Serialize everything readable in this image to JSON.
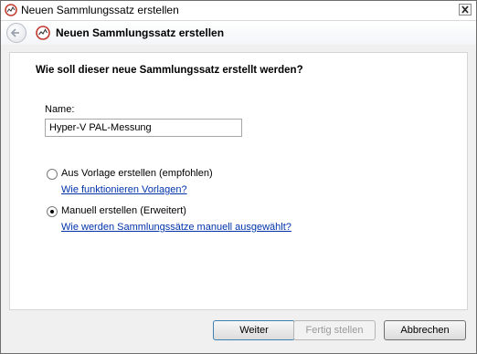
{
  "window": {
    "title": "Neuen Sammlungssatz erstellen"
  },
  "nav": {
    "title": "Neuen Sammlungssatz erstellen"
  },
  "page": {
    "question": "Wie soll dieser neue Sammlungssatz erstellt werden?",
    "name_label": "Name:",
    "name_value": "Hyper-V PAL-Messung"
  },
  "options": [
    {
      "label": "Aus Vorlage erstellen (empfohlen)",
      "link": "Wie funktionieren Vorlagen?",
      "selected": false
    },
    {
      "label": "Manuell erstellen (Erweitert)",
      "link": "Wie werden Sammlungssätze manuell ausgewählt?",
      "selected": true
    }
  ],
  "buttons": {
    "next": "Weiter",
    "finish": "Fertig stellen",
    "cancel": "Abbrechen"
  },
  "icons": {
    "window_icon": "performance-monitor-icon",
    "nav_icon": "performance-monitor-icon",
    "back": "back-arrow-icon",
    "close": "close-icon"
  }
}
